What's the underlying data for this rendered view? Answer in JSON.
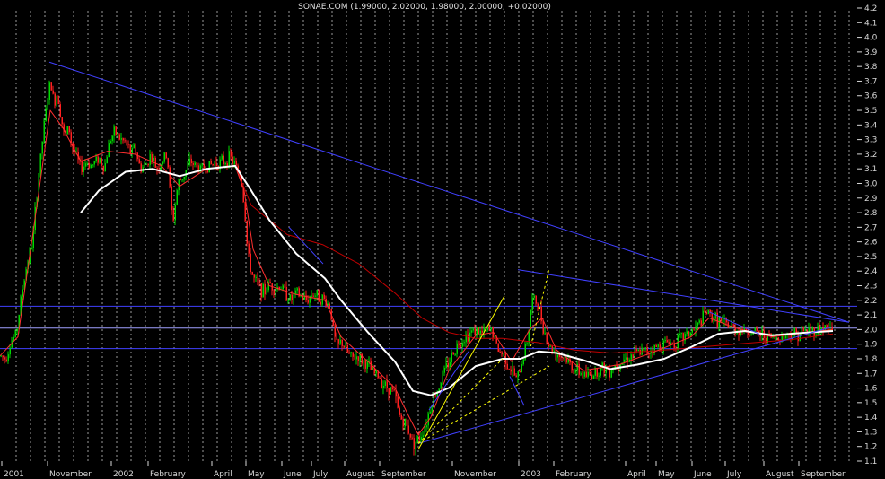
{
  "chart_data": {
    "type": "candlestick",
    "title": "SONAE.COM (1.99000, 2.02000, 1.98000, 2.00000, +0.02000)",
    "grid": true,
    "ylim": [
      1.1,
      4.2
    ],
    "y_ticks": [
      "4.2",
      "4.1",
      "4.0",
      "3.9",
      "3.8",
      "3.7",
      "3.6",
      "3.5",
      "3.4",
      "3.3",
      "3.2",
      "3.1",
      "3.0",
      "2.9",
      "2.8",
      "2.7",
      "2.6",
      "2.5",
      "2.4",
      "2.3",
      "2.2",
      "2.1",
      "2.0",
      "1.9",
      "1.8",
      "1.7",
      "1.6",
      "1.5",
      "1.4",
      "1.3",
      "1.2",
      "1.1"
    ],
    "x_ticks": [
      "2001",
      "November",
      "2002",
      "February",
      "April",
      "May",
      "June",
      "July",
      "August",
      "September",
      "November",
      "2003",
      "February",
      "April",
      "May",
      "June",
      "July",
      "August",
      "September"
    ],
    "colors": {
      "background": "#000000",
      "grid": "#9a9a9a",
      "up_candle": "#00d800",
      "down_candle": "#ff2020",
      "ma_short": "#ff3030",
      "ma_mid": "#ffffff",
      "ma_long": "#c00000",
      "trendline": "#3030ff",
      "level_line": "#4040ff",
      "fan_line": "#ffff00",
      "axis_text": "#d8d8d8"
    },
    "price_path": [
      [
        0,
        1.82
      ],
      [
        6,
        1.8
      ],
      [
        12,
        1.92
      ],
      [
        18,
        1.97
      ],
      [
        24,
        2.25
      ],
      [
        30,
        2.45
      ],
      [
        36,
        2.6
      ],
      [
        42,
        3.0
      ],
      [
        48,
        3.35
      ],
      [
        52,
        3.55
      ],
      [
        56,
        3.7
      ],
      [
        60,
        3.55
      ],
      [
        64,
        3.62
      ],
      [
        68,
        3.45
      ],
      [
        72,
        3.3
      ],
      [
        76,
        3.4
      ],
      [
        80,
        3.25
      ],
      [
        84,
        3.2
      ],
      [
        90,
        3.1
      ],
      [
        96,
        3.15
      ],
      [
        102,
        3.12
      ],
      [
        110,
        3.18
      ],
      [
        116,
        3.1
      ],
      [
        122,
        3.3
      ],
      [
        128,
        3.35
      ],
      [
        134,
        3.3
      ],
      [
        140,
        3.28
      ],
      [
        146,
        3.2
      ],
      [
        150,
        3.25
      ],
      [
        156,
        3.1
      ],
      [
        162,
        3.12
      ],
      [
        168,
        3.2
      ],
      [
        174,
        3.1
      ],
      [
        180,
        3.15
      ],
      [
        186,
        3.2
      ],
      [
        192,
        2.72
      ],
      [
        198,
        3.0
      ],
      [
        204,
        3.05
      ],
      [
        212,
        3.15
      ],
      [
        222,
        3.1
      ],
      [
        232,
        3.12
      ],
      [
        240,
        3.14
      ],
      [
        250,
        3.15
      ],
      [
        256,
        3.18
      ],
      [
        262,
        3.12
      ],
      [
        268,
        3.05
      ],
      [
        272,
        2.85
      ],
      [
        276,
        2.5
      ],
      [
        282,
        2.35
      ],
      [
        288,
        2.3
      ],
      [
        294,
        2.25
      ],
      [
        300,
        2.32
      ],
      [
        306,
        2.28
      ],
      [
        312,
        2.3
      ],
      [
        318,
        2.25
      ],
      [
        324,
        2.2
      ],
      [
        330,
        2.25
      ],
      [
        336,
        2.22
      ],
      [
        342,
        2.2
      ],
      [
        348,
        2.25
      ],
      [
        356,
        2.22
      ],
      [
        362,
        2.2
      ],
      [
        368,
        2.15
      ],
      [
        372,
        1.95
      ],
      [
        376,
        1.88
      ],
      [
        380,
        1.92
      ],
      [
        386,
        1.85
      ],
      [
        392,
        1.8
      ],
      [
        398,
        1.82
      ],
      [
        404,
        1.78
      ],
      [
        410,
        1.75
      ],
      [
        416,
        1.7
      ],
      [
        422,
        1.68
      ],
      [
        428,
        1.62
      ],
      [
        434,
        1.6
      ],
      [
        440,
        1.55
      ],
      [
        444,
        1.42
      ],
      [
        448,
        1.38
      ],
      [
        452,
        1.35
      ],
      [
        456,
        1.3
      ],
      [
        460,
        1.22
      ],
      [
        466,
        1.25
      ],
      [
        470,
        1.3
      ],
      [
        474,
        1.35
      ],
      [
        478,
        1.45
      ],
      [
        482,
        1.52
      ],
      [
        488,
        1.6
      ],
      [
        494,
        1.7
      ],
      [
        500,
        1.78
      ],
      [
        506,
        1.86
      ],
      [
        512,
        1.92
      ],
      [
        518,
        1.95
      ],
      [
        524,
        1.98
      ],
      [
        530,
        2.0
      ],
      [
        536,
        1.97
      ],
      [
        542,
        1.99
      ],
      [
        548,
        2.0
      ],
      [
        552,
        1.9
      ],
      [
        556,
        1.85
      ],
      [
        562,
        1.82
      ],
      [
        566,
        1.75
      ],
      [
        572,
        1.7
      ],
      [
        576,
        1.65
      ],
      [
        580,
        1.75
      ],
      [
        584,
        1.85
      ],
      [
        588,
        1.95
      ],
      [
        592,
        2.2
      ],
      [
        596,
        2.2
      ],
      [
        600,
        2.15
      ],
      [
        604,
        2.05
      ],
      [
        608,
        1.95
      ],
      [
        612,
        1.88
      ],
      [
        618,
        1.85
      ],
      [
        624,
        1.82
      ],
      [
        630,
        1.8
      ],
      [
        636,
        1.75
      ],
      [
        642,
        1.72
      ],
      [
        648,
        1.7
      ],
      [
        654,
        1.68
      ],
      [
        660,
        1.7
      ],
      [
        666,
        1.72
      ],
      [
        672,
        1.74
      ],
      [
        678,
        1.72
      ],
      [
        684,
        1.75
      ],
      [
        690,
        1.78
      ],
      [
        696,
        1.8
      ],
      [
        702,
        1.82
      ],
      [
        708,
        1.83
      ],
      [
        714,
        1.85
      ],
      [
        720,
        1.85
      ],
      [
        726,
        1.87
      ],
      [
        732,
        1.88
      ],
      [
        738,
        1.9
      ],
      [
        744,
        1.92
      ],
      [
        750,
        1.9
      ],
      [
        756,
        1.93
      ],
      [
        762,
        1.95
      ],
      [
        768,
        1.98
      ],
      [
        774,
        2.0
      ],
      [
        780,
        2.05
      ],
      [
        786,
        2.12
      ],
      [
        790,
        2.1
      ],
      [
        796,
        2.08
      ],
      [
        802,
        2.05
      ],
      [
        808,
        2.03
      ],
      [
        814,
        2.02
      ],
      [
        820,
        2.0
      ],
      [
        826,
        2.0
      ],
      [
        832,
        1.99
      ],
      [
        838,
        1.98
      ],
      [
        844,
        1.97
      ],
      [
        850,
        1.96
      ],
      [
        856,
        1.95
      ],
      [
        862,
        1.94
      ],
      [
        868,
        1.95
      ],
      [
        874,
        1.96
      ],
      [
        880,
        1.97
      ],
      [
        886,
        1.97
      ],
      [
        892,
        1.98
      ],
      [
        898,
        1.99
      ],
      [
        904,
        1.99
      ],
      [
        910,
        2.0
      ],
      [
        916,
        2.01
      ],
      [
        922,
        2.01
      ],
      [
        928,
        2.0
      ]
    ],
    "ma_short": [
      [
        0,
        1.82
      ],
      [
        20,
        1.95
      ],
      [
        40,
        2.8
      ],
      [
        56,
        3.5
      ],
      [
        70,
        3.38
      ],
      [
        90,
        3.15
      ],
      [
        120,
        3.22
      ],
      [
        150,
        3.2
      ],
      [
        180,
        3.12
      ],
      [
        200,
        2.98
      ],
      [
        230,
        3.1
      ],
      [
        262,
        3.12
      ],
      [
        272,
        2.95
      ],
      [
        282,
        2.55
      ],
      [
        300,
        2.3
      ],
      [
        330,
        2.24
      ],
      [
        362,
        2.2
      ],
      [
        380,
        1.95
      ],
      [
        410,
        1.78
      ],
      [
        440,
        1.6
      ],
      [
        456,
        1.4
      ],
      [
        466,
        1.28
      ],
      [
        480,
        1.4
      ],
      [
        500,
        1.72
      ],
      [
        530,
        1.96
      ],
      [
        550,
        1.98
      ],
      [
        570,
        1.78
      ],
      [
        590,
        2.0
      ],
      [
        604,
        2.08
      ],
      [
        620,
        1.86
      ],
      [
        650,
        1.72
      ],
      [
        690,
        1.76
      ],
      [
        730,
        1.85
      ],
      [
        770,
        1.95
      ],
      [
        790,
        2.08
      ],
      [
        820,
        2.01
      ],
      [
        860,
        1.95
      ],
      [
        900,
        1.98
      ],
      [
        928,
        2.0
      ]
    ],
    "ma_mid": [
      [
        90,
        2.8
      ],
      [
        110,
        2.95
      ],
      [
        140,
        3.08
      ],
      [
        170,
        3.1
      ],
      [
        200,
        3.05
      ],
      [
        230,
        3.1
      ],
      [
        262,
        3.12
      ],
      [
        280,
        2.95
      ],
      [
        300,
        2.75
      ],
      [
        330,
        2.52
      ],
      [
        362,
        2.35
      ],
      [
        380,
        2.2
      ],
      [
        410,
        1.98
      ],
      [
        440,
        1.78
      ],
      [
        460,
        1.58
      ],
      [
        480,
        1.55
      ],
      [
        500,
        1.6
      ],
      [
        530,
        1.75
      ],
      [
        560,
        1.8
      ],
      [
        580,
        1.8
      ],
      [
        600,
        1.85
      ],
      [
        620,
        1.84
      ],
      [
        650,
        1.79
      ],
      [
        680,
        1.73
      ],
      [
        710,
        1.76
      ],
      [
        740,
        1.8
      ],
      [
        770,
        1.88
      ],
      [
        800,
        1.97
      ],
      [
        830,
        1.99
      ],
      [
        860,
        1.96
      ],
      [
        900,
        1.98
      ],
      [
        928,
        1.99
      ]
    ],
    "ma_long": [
      [
        262,
        3.12
      ],
      [
        280,
        2.85
      ],
      [
        320,
        2.65
      ],
      [
        360,
        2.58
      ],
      [
        400,
        2.45
      ],
      [
        440,
        2.25
      ],
      [
        470,
        2.08
      ],
      [
        500,
        1.98
      ],
      [
        530,
        1.94
      ],
      [
        560,
        1.94
      ],
      [
        600,
        1.91
      ],
      [
        640,
        1.86
      ],
      [
        680,
        1.84
      ],
      [
        720,
        1.85
      ],
      [
        760,
        1.87
      ],
      [
        800,
        1.89
      ],
      [
        840,
        1.91
      ],
      [
        880,
        1.93
      ],
      [
        928,
        1.97
      ]
    ],
    "horizontal_levels": [
      2.16,
      2.01,
      1.87,
      1.6
    ],
    "trendlines": [
      {
        "from": [
          55,
          3.83
        ],
        "to": [
          946,
          2.05
        ],
        "color": "level_line"
      },
      {
        "from": [
          577,
          2.41
        ],
        "to": [
          946,
          2.05
        ],
        "color": "level_line"
      },
      {
        "from": [
          466,
          1.22
        ],
        "to": [
          928,
          2.02
        ],
        "color": "level_line"
      },
      {
        "from": [
          322,
          2.7
        ],
        "to": [
          360,
          2.45
        ],
        "color": "level_line"
      },
      {
        "from": [
          478,
          1.45
        ],
        "to": [
          522,
          1.85
        ],
        "color": "level_line"
      },
      {
        "from": [
          568,
          1.68
        ],
        "to": [
          584,
          1.48
        ],
        "color": "level_line"
      },
      {
        "from": [
          790,
          2.12
        ],
        "to": [
          846,
          1.97
        ],
        "color": "level_line"
      },
      {
        "from": [
          466,
          1.18
        ],
        "to": [
          562,
          2.23
        ],
        "color": "fan_line"
      },
      {
        "from": [
          466,
          1.22
        ],
        "to": [
          560,
          1.8
        ],
        "color": "fan_line",
        "dashed": true
      },
      {
        "from": [
          466,
          1.22
        ],
        "to": [
          612,
          1.75
        ],
        "color": "fan_line",
        "dashed": true
      },
      {
        "from": [
          590,
          1.85
        ],
        "to": [
          612,
          2.42
        ],
        "color": "fan_line",
        "dashed": true
      }
    ]
  }
}
